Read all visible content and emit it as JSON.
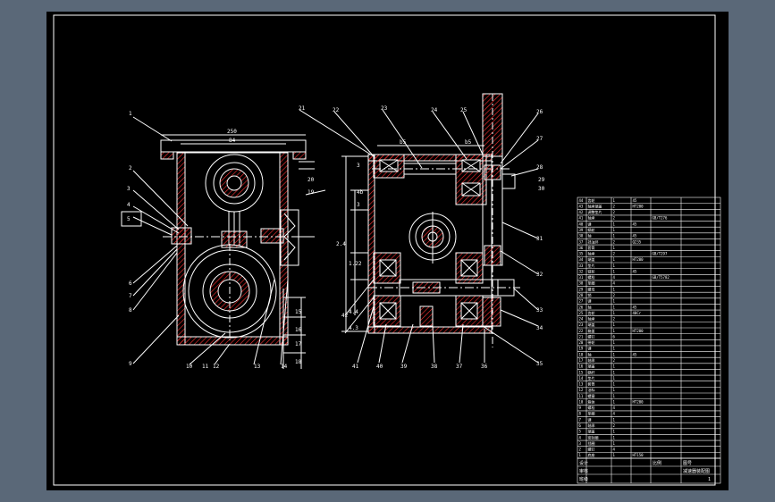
{
  "colors": {
    "background": "#5a6878",
    "paper": "#000000",
    "line": "#ffffff",
    "hatch": "#ff3030",
    "center": "#ffffff"
  },
  "left_view": {
    "dimensions": [
      "250",
      "84"
    ],
    "callouts": [
      "1",
      "2",
      "3",
      "4",
      "5",
      "6",
      "7",
      "8",
      "9",
      "10",
      "11",
      "12",
      "13",
      "14",
      "15",
      "16",
      "17",
      "18",
      "19",
      "20"
    ]
  },
  "right_view": {
    "dimensions": [
      "b5",
      "b5",
      "3",
      "4b",
      "3",
      "2.4",
      "1.22",
      "4.4",
      "4.3"
    ],
    "callouts": [
      "21",
      "22",
      "23",
      "24",
      "25",
      "26",
      "27",
      "28",
      "29",
      "30",
      "31",
      "32",
      "33",
      "34",
      "35",
      "36",
      "37",
      "38",
      "39",
      "40",
      "41",
      "42"
    ]
  },
  "parts_table": {
    "rows": [
      [
        "44",
        "齿轮",
        "1",
        "45",
        "",
        ""
      ],
      [
        "43",
        "轴承端盖",
        "2",
        "HT200",
        "",
        ""
      ],
      [
        "42",
        "调整垫片",
        "2",
        "",
        "",
        ""
      ],
      [
        "41",
        "轴承",
        "2",
        "",
        "GB/T276",
        ""
      ],
      [
        "40",
        "键",
        "1",
        "45",
        "",
        ""
      ],
      [
        "39",
        "蜗轮",
        "1",
        "",
        "",
        ""
      ],
      [
        "38",
        "轴",
        "1",
        "45",
        "",
        ""
      ],
      [
        "37",
        "挡油环",
        "2",
        "Q235",
        "",
        ""
      ],
      [
        "36",
        "套筒",
        "1",
        "",
        "",
        ""
      ],
      [
        "35",
        "轴承",
        "2",
        "",
        "GB/T297",
        ""
      ],
      [
        "34",
        "端盖",
        "1",
        "HT200",
        "",
        ""
      ],
      [
        "33",
        "垫片",
        "1",
        "",
        "",
        ""
      ],
      [
        "32",
        "链轮",
        "1",
        "45",
        "",
        ""
      ],
      [
        "31",
        "螺栓",
        "4",
        "",
        "GB/T5782",
        ""
      ],
      [
        "30",
        "垫圈",
        "4",
        "",
        "",
        ""
      ],
      [
        "29",
        "螺母",
        "1",
        "",
        "",
        ""
      ],
      [
        "28",
        "销",
        "2",
        "",
        "",
        ""
      ],
      [
        "27",
        "键",
        "1",
        "",
        "",
        ""
      ],
      [
        "26",
        "轴",
        "1",
        "45",
        "",
        ""
      ],
      [
        "25",
        "齿轮",
        "1",
        "40Cr",
        "",
        ""
      ],
      [
        "24",
        "轴承",
        "2",
        "",
        "",
        ""
      ],
      [
        "23",
        "端盖",
        "1",
        "",
        "",
        ""
      ],
      [
        "22",
        "箱盖",
        "1",
        "HT200",
        "",
        ""
      ],
      [
        "21",
        "螺钉",
        "6",
        "",
        "",
        ""
      ],
      [
        "20",
        "带轮",
        "1",
        "",
        "",
        ""
      ],
      [
        "19",
        "键",
        "1",
        "",
        "",
        ""
      ],
      [
        "18",
        "轴",
        "1",
        "45",
        "",
        ""
      ],
      [
        "17",
        "轴承",
        "2",
        "",
        "",
        ""
      ],
      [
        "16",
        "端盖",
        "1",
        "",
        "",
        ""
      ],
      [
        "15",
        "蜗杆",
        "1",
        "",
        "",
        ""
      ],
      [
        "14",
        "垫片",
        "1",
        "",
        "",
        ""
      ],
      [
        "13",
        "套筒",
        "1",
        "",
        "",
        ""
      ],
      [
        "12",
        "油标",
        "1",
        "",
        "",
        ""
      ],
      [
        "11",
        "螺塞",
        "1",
        "",
        "",
        ""
      ],
      [
        "10",
        "箱体",
        "1",
        "HT200",
        "",
        ""
      ],
      [
        "9",
        "螺栓",
        "4",
        "",
        "",
        ""
      ],
      [
        "8",
        "垫圈",
        "4",
        "",
        "",
        ""
      ],
      [
        "7",
        "键",
        "1",
        "",
        "",
        ""
      ],
      [
        "6",
        "轴承",
        "2",
        "",
        "",
        ""
      ],
      [
        "5",
        "端盖",
        "1",
        "",
        "",
        ""
      ],
      [
        "4",
        "密封圈",
        "1",
        "",
        "",
        ""
      ],
      [
        "3",
        "挡圈",
        "1",
        "",
        "",
        ""
      ],
      [
        "2",
        "螺钉",
        "4",
        "",
        "",
        ""
      ],
      [
        "1",
        "底座",
        "1",
        "HT150",
        "",
        ""
      ]
    ],
    "title_block": {
      "row1": [
        "设计",
        "",
        "",
        "",
        "比例",
        "图号"
      ],
      "row2": [
        "审核",
        "",
        "",
        "",
        "",
        ""
      ],
      "row3": [
        "班级",
        "",
        "",
        "",
        "",
        ""
      ],
      "drawing_name": "减速器装配图",
      "sheet": "1"
    }
  }
}
